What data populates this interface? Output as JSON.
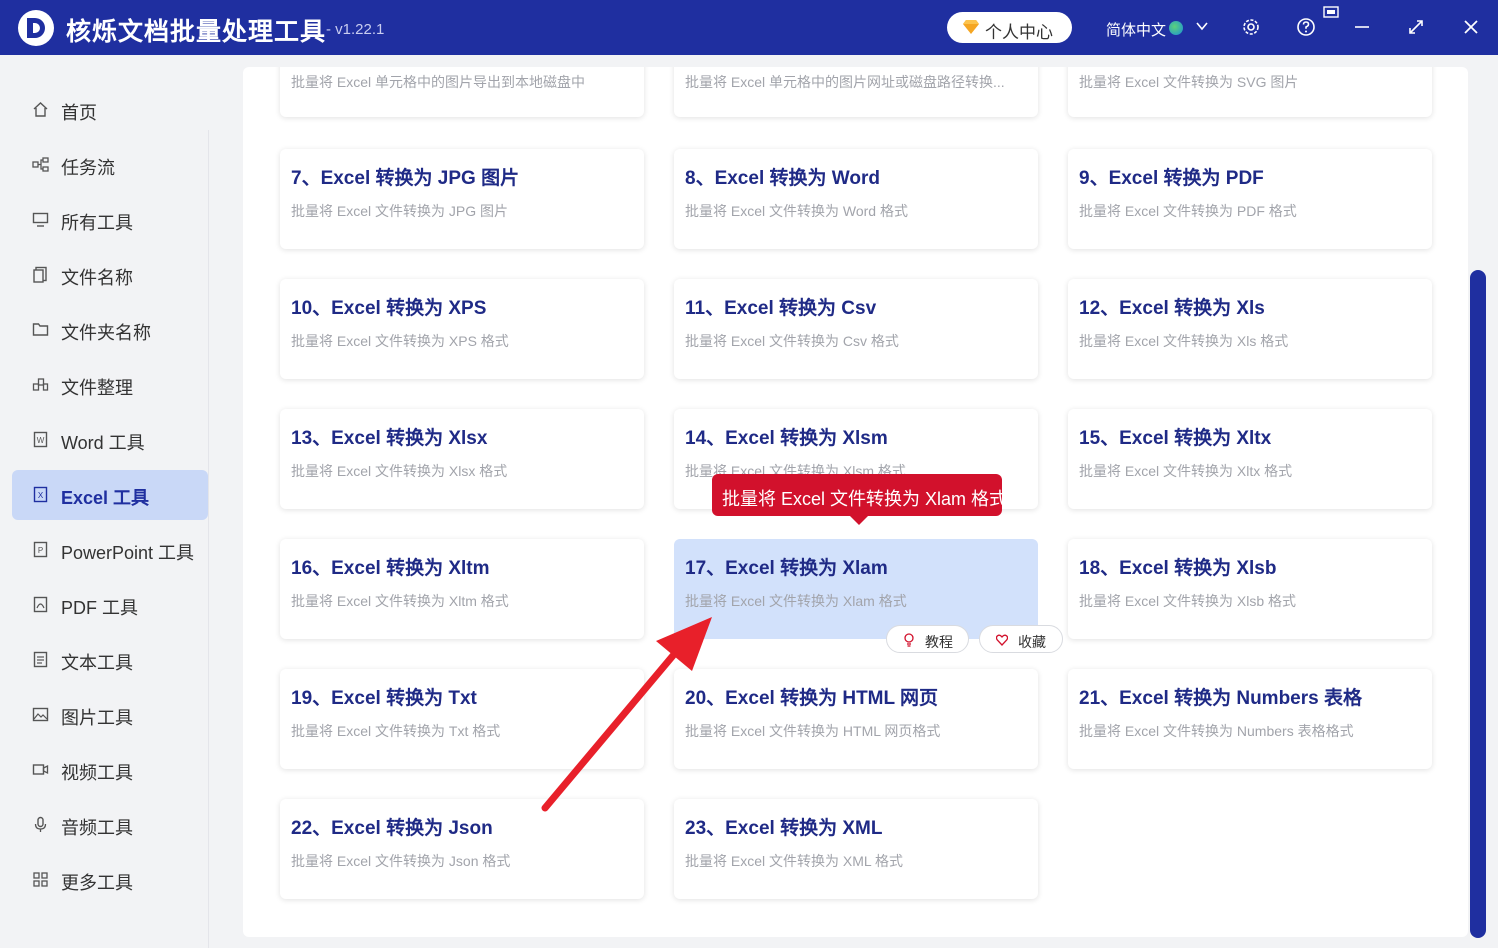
{
  "app": {
    "title": "核烁文档批量处理工具",
    "version": "- v1.22.1",
    "user_center": "个人中心",
    "language": "简体中文"
  },
  "sidebar": {
    "items": [
      {
        "label": "首页",
        "icon": "home-icon"
      },
      {
        "label": "任务流",
        "icon": "workflow-icon"
      },
      {
        "label": "所有工具",
        "icon": "monitor-icon"
      },
      {
        "label": "文件名称",
        "icon": "file-name-icon"
      },
      {
        "label": "文件夹名称",
        "icon": "folder-icon"
      },
      {
        "label": "文件整理",
        "icon": "organize-icon"
      },
      {
        "label": "Word 工具",
        "icon": "word-icon"
      },
      {
        "label": "Excel 工具",
        "icon": "excel-icon",
        "active": true
      },
      {
        "label": "PowerPoint 工具",
        "icon": "powerpoint-icon"
      },
      {
        "label": "PDF 工具",
        "icon": "pdf-icon"
      },
      {
        "label": "文本工具",
        "icon": "text-icon"
      },
      {
        "label": "图片工具",
        "icon": "image-icon"
      },
      {
        "label": "视频工具",
        "icon": "video-icon"
      },
      {
        "label": "音频工具",
        "icon": "audio-icon"
      },
      {
        "label": "更多工具",
        "icon": "more-tools-icon"
      }
    ]
  },
  "cards": [
    {
      "title": "",
      "desc": "批量将 Excel 单元格中的图片导出到本地磁盘中"
    },
    {
      "title": "",
      "desc": "批量将 Excel 单元格中的图片网址或磁盘路径转换..."
    },
    {
      "title": "",
      "desc": "批量将 Excel 文件转换为 SVG 图片"
    },
    {
      "title": "7、Excel 转换为 JPG 图片",
      "desc": "批量将 Excel 文件转换为 JPG 图片"
    },
    {
      "title": "8、Excel 转换为 Word",
      "desc": "批量将 Excel 文件转换为 Word 格式"
    },
    {
      "title": "9、Excel 转换为 PDF",
      "desc": "批量将 Excel 文件转换为 PDF 格式"
    },
    {
      "title": "10、Excel 转换为 XPS",
      "desc": "批量将 Excel 文件转换为 XPS 格式"
    },
    {
      "title": "11、Excel 转换为 Csv",
      "desc": "批量将 Excel 文件转换为 Csv 格式"
    },
    {
      "title": "12、Excel 转换为 Xls",
      "desc": "批量将 Excel 文件转换为 Xls 格式"
    },
    {
      "title": "13、Excel 转换为 Xlsx",
      "desc": "批量将 Excel 文件转换为 Xlsx 格式"
    },
    {
      "title": "14、Excel 转换为 Xlsm",
      "desc": "批量将 Excel 文件转换为 Xlsm 格式"
    },
    {
      "title": "15、Excel 转换为 Xltx",
      "desc": "批量将 Excel 文件转换为 Xltx 格式"
    },
    {
      "title": "16、Excel 转换为 Xltm",
      "desc": "批量将 Excel 文件转换为 Xltm 格式"
    },
    {
      "title": "17、Excel 转换为 Xlam",
      "desc": "批量将 Excel 文件转换为 Xlam 格式"
    },
    {
      "title": "18、Excel 转换为 Xlsb",
      "desc": "批量将 Excel 文件转换为 Xlsb 格式"
    },
    {
      "title": "19、Excel 转换为 Txt",
      "desc": "批量将 Excel 文件转换为 Txt 格式"
    },
    {
      "title": "20、Excel 转换为 HTML 网页",
      "desc": "批量将 Excel 文件转换为 HTML 网页格式"
    },
    {
      "title": "21、Excel 转换为 Numbers 表格",
      "desc": "批量将 Excel 文件转换为 Numbers 表格格式"
    },
    {
      "title": "22、Excel 转换为 Json",
      "desc": "批量将 Excel 文件转换为 Json 格式"
    },
    {
      "title": "23、Excel 转换为 XML",
      "desc": "批量将 Excel 文件转换为 XML 格式"
    }
  ],
  "card_actions": {
    "tutorial": "教程",
    "favorite": "收藏"
  },
  "tooltip": {
    "text": "批量将 Excel 文件转换为 Xlam 格式"
  },
  "colors": {
    "brand": "#1f2fa0",
    "card_title": "#1f2a86",
    "highlight": "#d2e1fb",
    "tooltip": "#d2112c",
    "arrow": "#e8202a"
  }
}
